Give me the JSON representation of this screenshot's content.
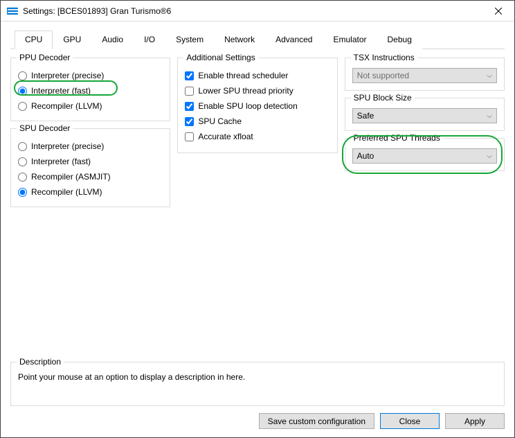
{
  "window": {
    "title": "Settings: [BCES01893] Gran Turismo®6"
  },
  "tabs": [
    "CPU",
    "GPU",
    "Audio",
    "I/O",
    "System",
    "Network",
    "Advanced",
    "Emulator",
    "Debug"
  ],
  "active_tab": "CPU",
  "ppu": {
    "legend": "PPU Decoder",
    "options": {
      "precise": "Interpreter (precise)",
      "fast": "Interpreter (fast)",
      "llvm": "Recompiler (LLVM)"
    },
    "selected": "fast"
  },
  "spu": {
    "legend": "SPU Decoder",
    "options": {
      "precise": "Interpreter (precise)",
      "fast": "Interpreter (fast)",
      "asmjit": "Recompiler (ASMJIT)",
      "llvm": "Recompiler (LLVM)"
    },
    "selected": "llvm"
  },
  "additional": {
    "legend": "Additional Settings",
    "items": {
      "thread_sched": {
        "label": "Enable thread scheduler",
        "checked": true
      },
      "lower_spu": {
        "label": "Lower SPU thread priority",
        "checked": false
      },
      "loop_detect": {
        "label": "Enable SPU loop detection",
        "checked": true
      },
      "spu_cache": {
        "label": "SPU Cache",
        "checked": true
      },
      "acc_xfloat": {
        "label": "Accurate xfloat",
        "checked": false
      }
    }
  },
  "tsx": {
    "legend": "TSX Instructions",
    "value": "Not supported",
    "disabled": true
  },
  "spu_block": {
    "legend": "SPU Block Size",
    "value": "Safe"
  },
  "spu_threads": {
    "legend": "Preferred SPU Threads",
    "value": "Auto"
  },
  "description": {
    "legend": "Description",
    "text": "Point your mouse at an option to display a description in here."
  },
  "buttons": {
    "save": "Save custom configuration",
    "close": "Close",
    "apply": "Apply"
  }
}
